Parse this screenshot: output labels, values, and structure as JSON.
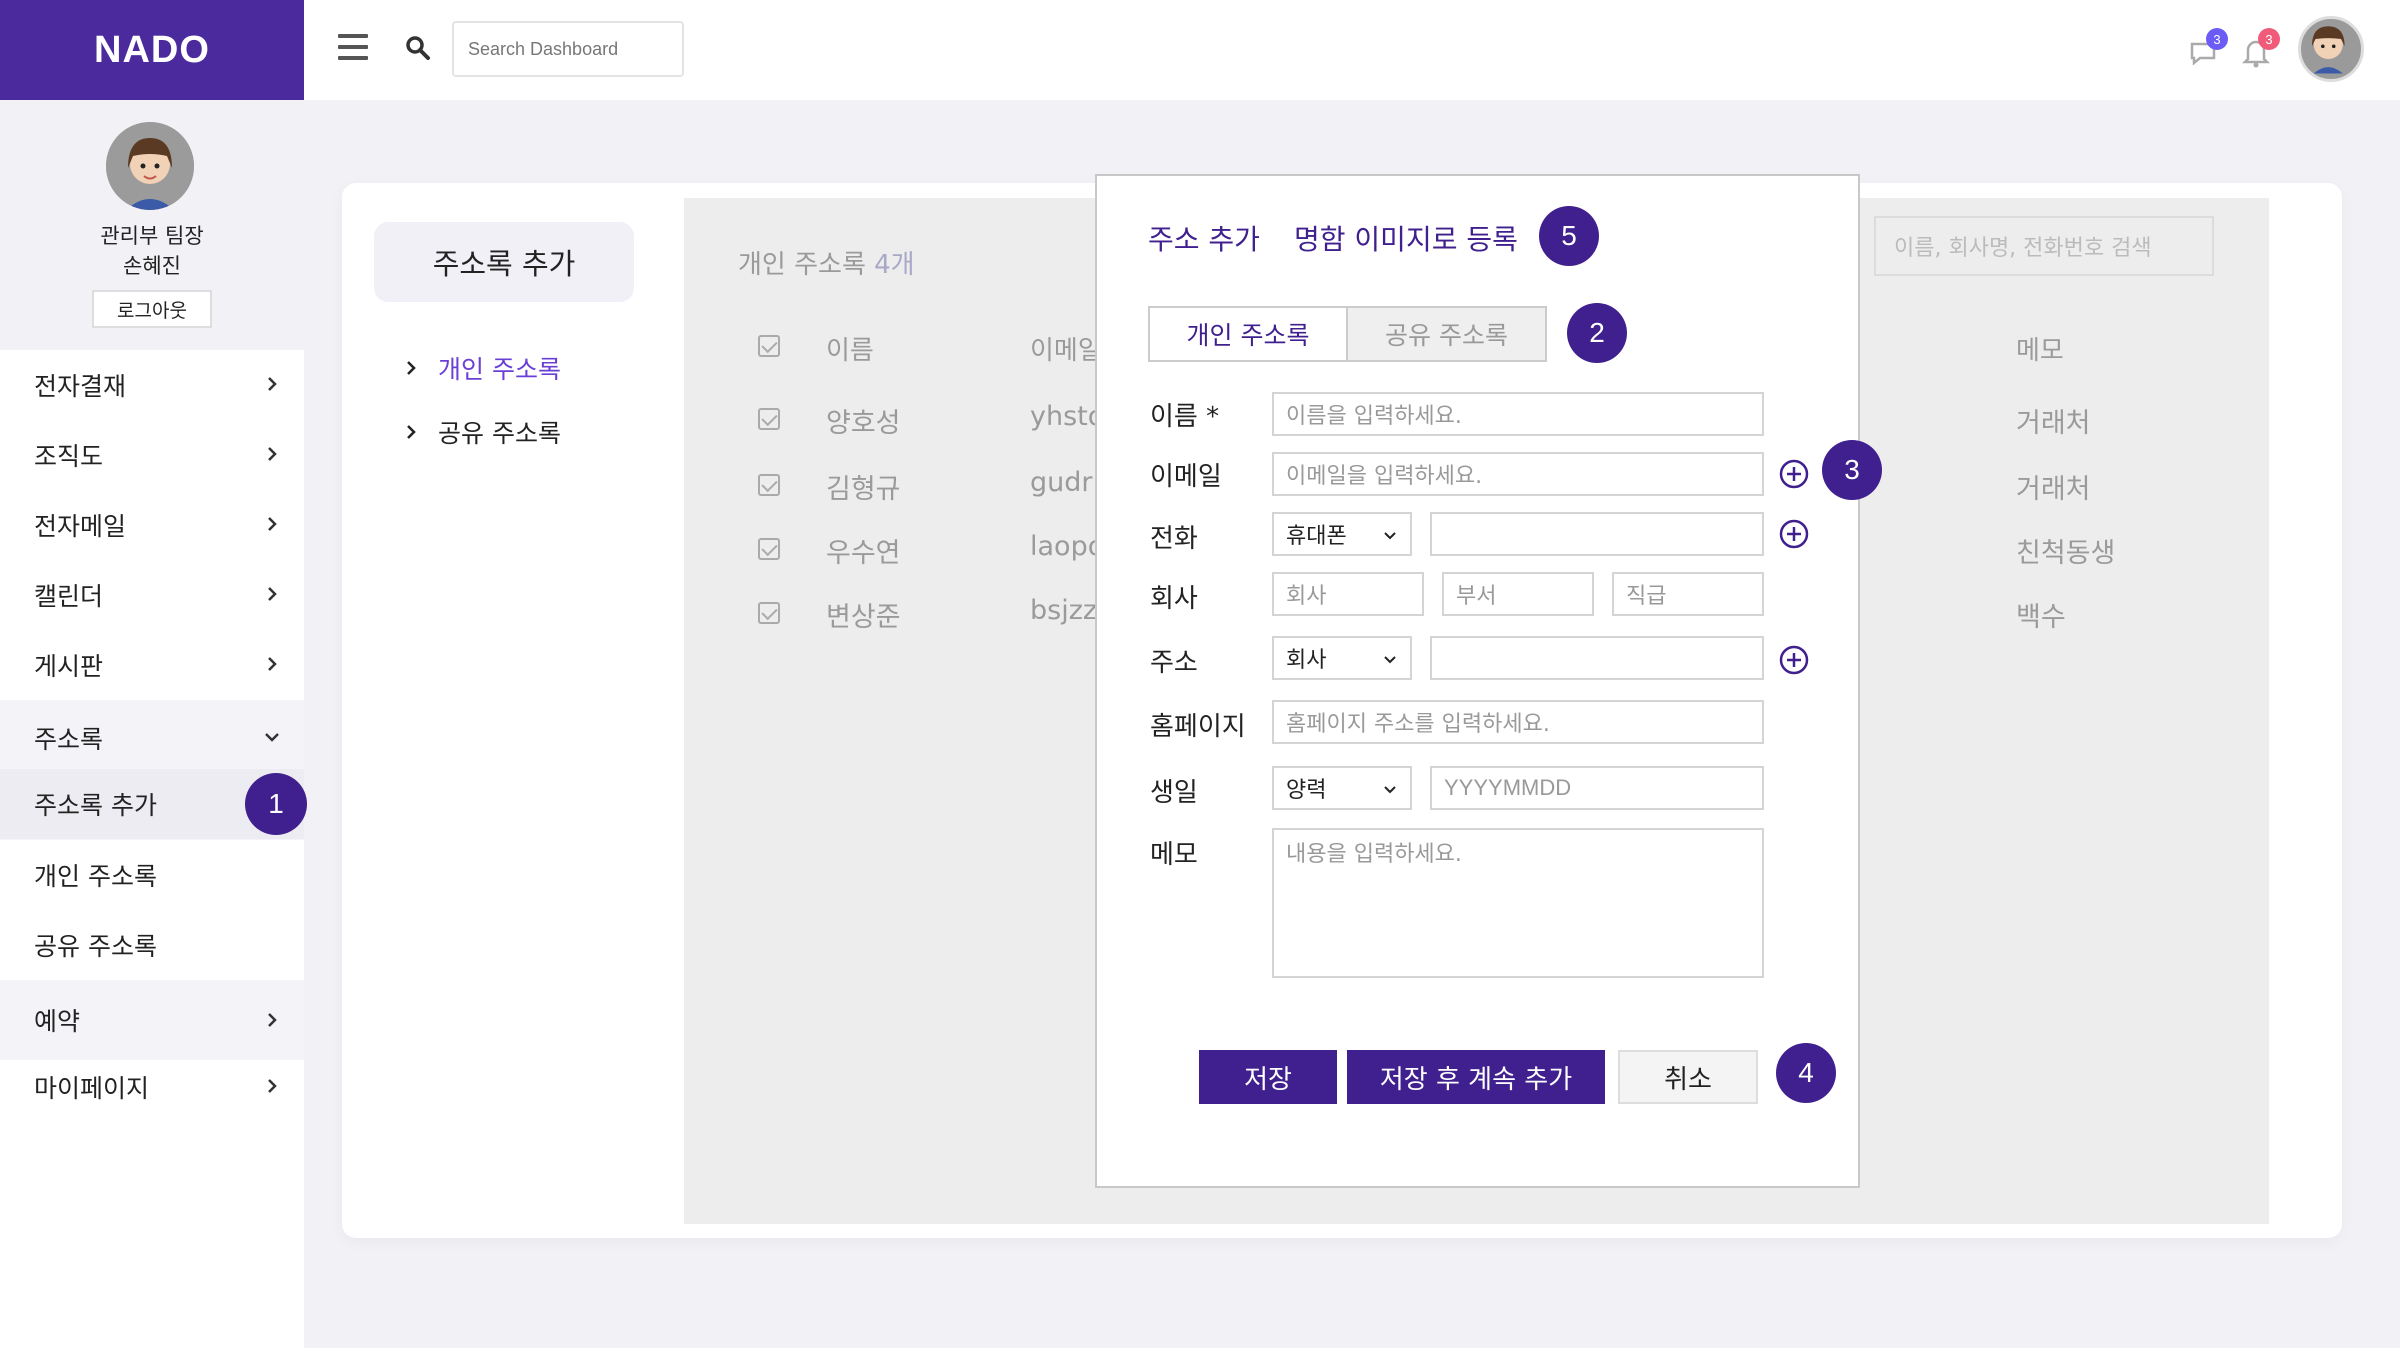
{
  "app": {
    "logo": "NADO"
  },
  "topbar": {
    "search_placeholder": "Search Dashboard",
    "notifications": [
      {
        "icon": "chat-bubble-icon",
        "count": "3",
        "color": "#6a5cf5"
      },
      {
        "icon": "bell-icon",
        "count": "3",
        "color": "#f05b7a"
      }
    ]
  },
  "profile": {
    "role": "관리부 팀장",
    "name": "손혜진",
    "logout": "로그아웃"
  },
  "sidebar": {
    "items": [
      {
        "label": "전자결재"
      },
      {
        "label": "조직도"
      },
      {
        "label": "전자메일"
      },
      {
        "label": "캘린더"
      },
      {
        "label": "게시판"
      },
      {
        "label": "주소록"
      },
      {
        "label": "주소록 추가"
      },
      {
        "label": "개인 주소록"
      },
      {
        "label": "공유 주소록"
      },
      {
        "label": "예약"
      },
      {
        "label": "마이페이지"
      }
    ]
  },
  "steps": [
    "1",
    "2",
    "3",
    "4",
    "5"
  ],
  "subnav": {
    "title": "주소록 추가",
    "links": [
      {
        "label": "개인 주소록",
        "active": true
      },
      {
        "label": "공유 주소록",
        "active": false
      }
    ]
  },
  "list": {
    "count_label": "개인 주소록",
    "count_value": "4개",
    "search_placeholder": "이름, 회사명, 전화번호 검색",
    "headers": {
      "name": "이름",
      "email": "이메일",
      "memo": "메모"
    },
    "rows": [
      {
        "name": "양호성",
        "email": "yhsto",
        "memo": "거래처"
      },
      {
        "name": "김형규",
        "email": "gudr",
        "memo": "거래처"
      },
      {
        "name": "우수연",
        "email": "laopo",
        "memo": "친척동생"
      },
      {
        "name": "변상준",
        "email": "bsjzz",
        "memo": "백수"
      }
    ]
  },
  "modal": {
    "tab_add": "주소 추가",
    "tab_card": "명함 이미지로 등록",
    "seg_personal": "개인 주소록",
    "seg_shared": "공유 주소록",
    "fields": {
      "name_label": "이름 *",
      "name_placeholder": "이름을 입력하세요.",
      "email_label": "이메일",
      "email_placeholder": "이메일을 입력하세요.",
      "phone_label": "전화",
      "phone_type": "휴대폰",
      "company_label": "회사",
      "company_placeholder": "회사",
      "dept_placeholder": "부서",
      "position_placeholder": "직급",
      "address_label": "주소",
      "address_type": "회사",
      "homepage_label": "홈페이지",
      "homepage_placeholder": "홈페이지 주소를 입력하세요.",
      "birthday_label": "생일",
      "birthday_type": "양력",
      "birthday_placeholder": "YYYYMMDD",
      "memo_label": "메모",
      "memo_placeholder": "내용을 입력하세요."
    },
    "buttons": {
      "save": "저장",
      "save_continue": "저장 후 계속 추가",
      "cancel": "취소"
    }
  },
  "colors": {
    "brand": "#4b2a9e",
    "accent": "#40208e",
    "link_active": "#6a3fd6"
  }
}
